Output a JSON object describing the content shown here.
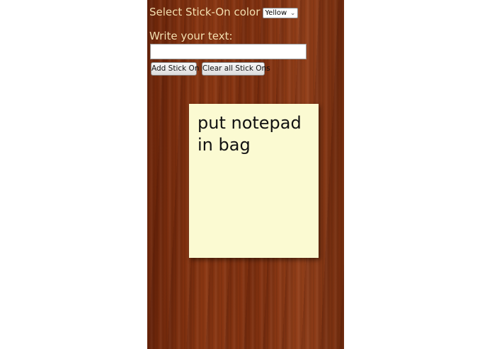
{
  "form": {
    "color_label": "Select Stick-On color",
    "color_selected": "Yellow",
    "text_label": "Write your text:",
    "text_value": "",
    "add_button_label": "Add Stick On",
    "clear_button_label": "Clear all Stick Ons"
  },
  "notes": [
    {
      "text": "put notepad\nin bag",
      "color": "#fbfad2"
    }
  ],
  "colors": {
    "label_text": "#f3dfb0",
    "wood_background": "#7a2e0f"
  }
}
